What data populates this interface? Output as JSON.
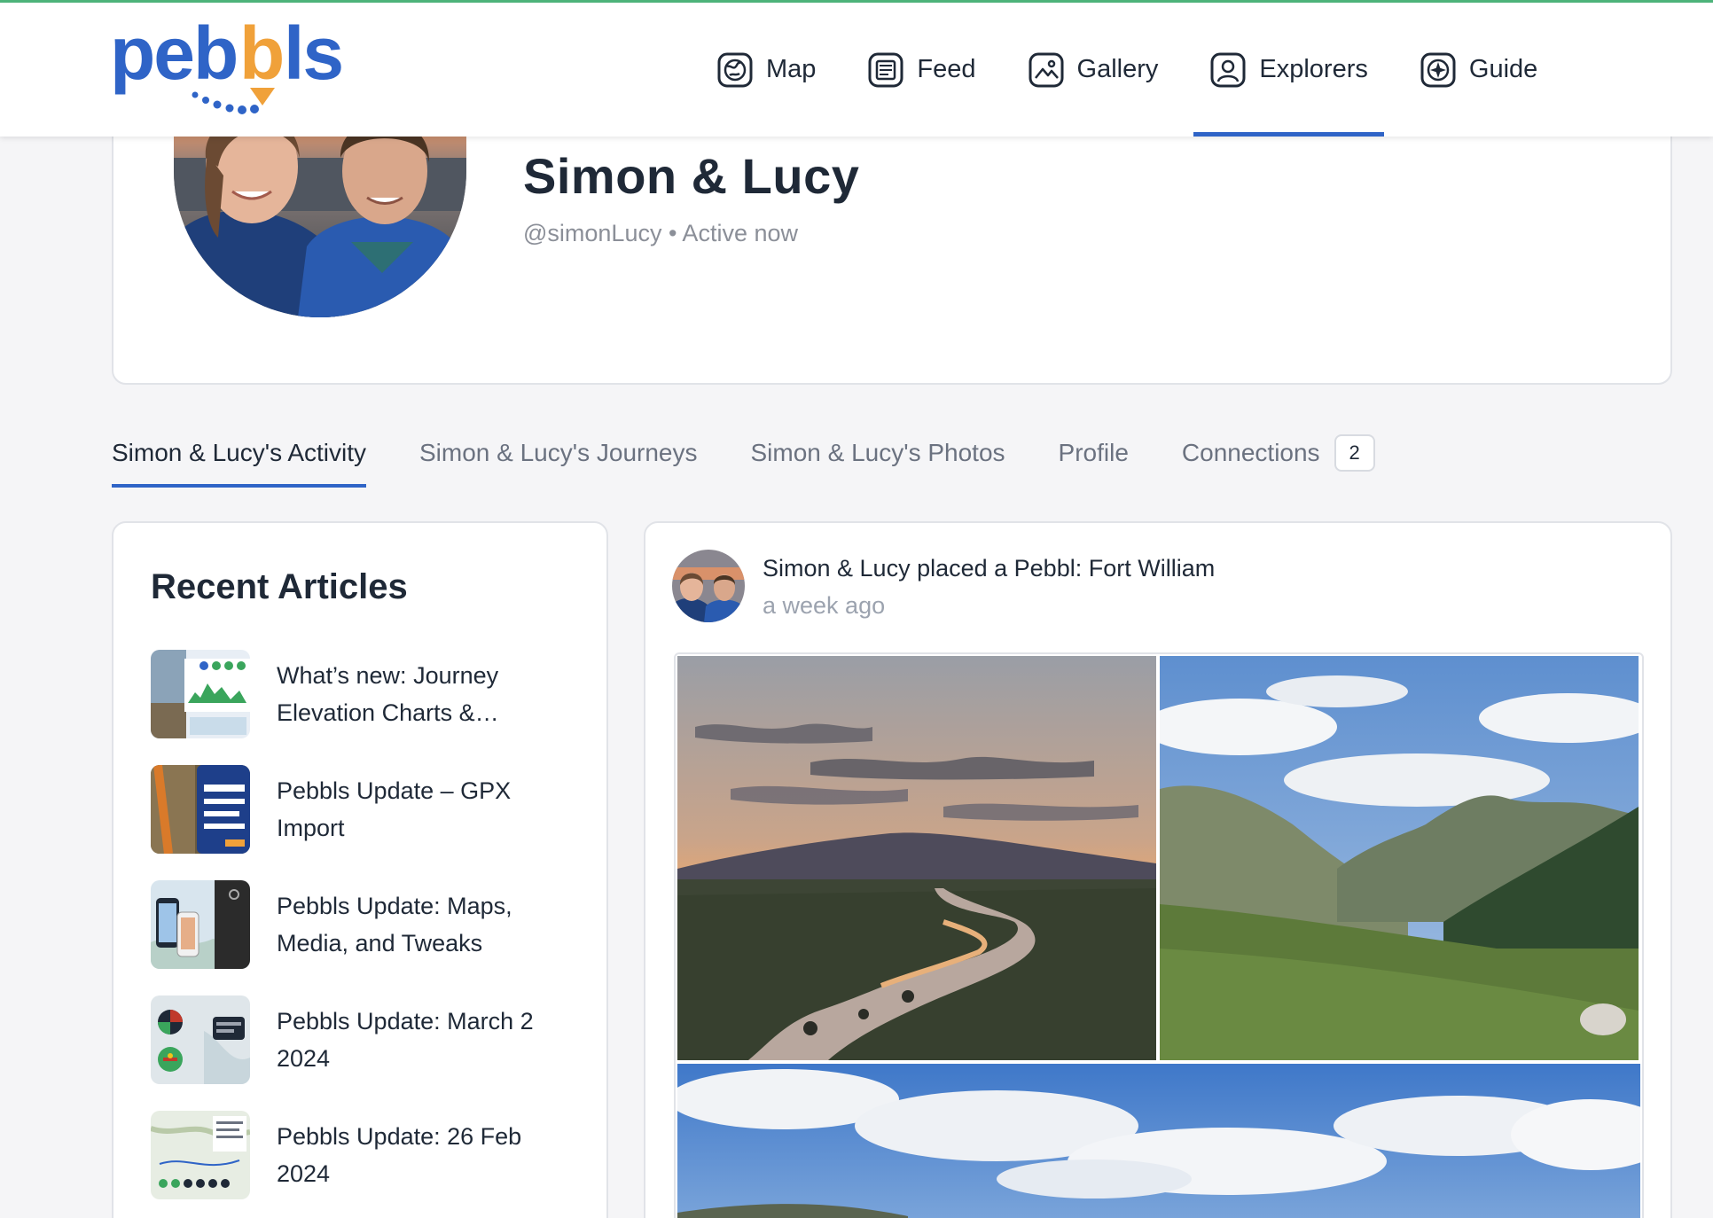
{
  "header": {
    "logo_text": "pebbls",
    "nav": [
      {
        "label": "Map",
        "icon": "globe-icon",
        "active": false
      },
      {
        "label": "Feed",
        "icon": "newspaper-icon",
        "active": false
      },
      {
        "label": "Gallery",
        "icon": "image-icon",
        "active": false
      },
      {
        "label": "Explorers",
        "icon": "user-icon",
        "active": true
      },
      {
        "label": "Guide",
        "icon": "compass-icon",
        "active": false
      }
    ]
  },
  "profile": {
    "name": "Simon & Lucy",
    "handle_status": "@simonLucy • Active now"
  },
  "tabs": [
    {
      "label": "Simon & Lucy's Activity",
      "active": true
    },
    {
      "label": "Simon & Lucy's Journeys",
      "active": false
    },
    {
      "label": "Simon & Lucy's Photos",
      "active": false
    },
    {
      "label": "Profile",
      "active": false
    },
    {
      "label": "Connections",
      "active": false,
      "badge": "2"
    }
  ],
  "recent_articles": {
    "title": "Recent Articles",
    "items": [
      {
        "title": "What’s new: Journey Elevation Charts &…"
      },
      {
        "title": "Pebbls Update – GPX Import"
      },
      {
        "title": "Pebbls Update: Maps, Media, and Tweaks"
      },
      {
        "title": "Pebbls Update: March 2 2024"
      },
      {
        "title": "Pebbls Update: 26 Feb 2024"
      }
    ]
  },
  "feed": {
    "activity_text": "Simon & Lucy placed a Pebbl: Fort William",
    "time": "a week ago"
  },
  "colors": {
    "brand_blue": "#2f64c7",
    "brand_orange": "#f0a13a",
    "top_accent": "#4db37a"
  }
}
